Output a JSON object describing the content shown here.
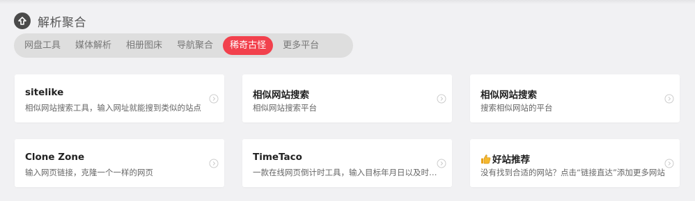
{
  "section": {
    "title": "解析聚合",
    "icon": "upload-circle-icon"
  },
  "tabs": [
    {
      "label": "网盘工具",
      "active": false
    },
    {
      "label": "媒体解析",
      "active": false
    },
    {
      "label": "相册图床",
      "active": false
    },
    {
      "label": "导航聚合",
      "active": false
    },
    {
      "label": "稀奇古怪",
      "active": true
    },
    {
      "label": "更多平台",
      "active": false
    }
  ],
  "colors": {
    "accent": "#f2414d",
    "tab_bar": "#dedede",
    "background": "#f1f1f3"
  },
  "cards": [
    {
      "title": "sitelike",
      "desc": "相似网站搜索工具，输入网址就能搜到类似的站点",
      "icon": "chevron-right-circle-icon"
    },
    {
      "title": "相似网站搜索",
      "desc": "相似网站搜索平台",
      "icon": "chevron-right-circle-icon"
    },
    {
      "title": "相似网站搜索",
      "desc": "搜索相似网站的平台",
      "icon": "chevron-right-circle-icon"
    },
    {
      "title": "Clone Zone",
      "desc": "输入网页链接，克隆一个一样的网页",
      "icon": "chevron-right-circle-icon"
    },
    {
      "title": "TimeTaco",
      "desc": "一款在线网页倒计时工具，输入目标年月日以及时间即可开始倒计时",
      "icon": "chevron-right-circle-icon"
    },
    {
      "title": "好站推荐",
      "title_icon": "thumbs-up-icon",
      "desc": "没有找到合适的网站？点击“链接直达”添加更多网站",
      "icon": "chevron-right-circle-icon"
    }
  ]
}
